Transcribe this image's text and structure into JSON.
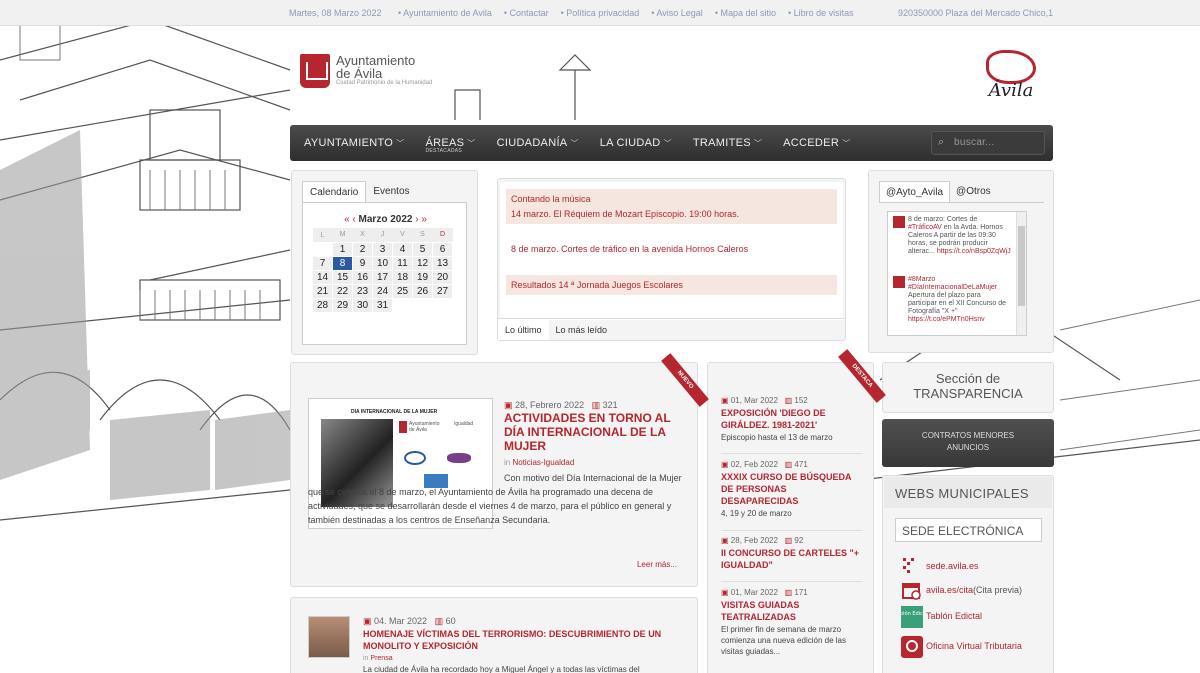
{
  "topbar": {
    "date": "Martes, 08 Marzo 2022",
    "links": [
      "Ayuntamiento de Avila",
      "Contactar",
      "Política privacidad",
      "Aviso Legal",
      "Mapa del sitio",
      "Libro de visitas"
    ],
    "address": "920350000 Plaza del Mercado Chico,1"
  },
  "logo": {
    "line1": "Ayuntamiento",
    "line2": "de Ávila",
    "tagline": "Ciudad Patrimonio de la Humanidad"
  },
  "avila_logo": "Ávila",
  "nav": {
    "items": [
      {
        "label": "AYUNTAMIENTO",
        "sub": ""
      },
      {
        "label": "ÁREAS",
        "sub": "DESTACADAS"
      },
      {
        "label": "CIUDADANÍA",
        "sub": ""
      },
      {
        "label": "LA CIUDAD",
        "sub": ""
      },
      {
        "label": "TRAMITES",
        "sub": ""
      },
      {
        "label": "ACCEDER",
        "sub": ""
      }
    ],
    "search_placeholder": "buscar..."
  },
  "calendar": {
    "tabs": [
      "Calendario",
      "Eventos"
    ],
    "month": "Marzo 2022",
    "prev": "« ‹",
    "next": "› »",
    "weekdays": [
      "L",
      "M",
      "X",
      "J",
      "V",
      "S",
      "D"
    ],
    "weeks": [
      [
        "",
        "1",
        "2",
        "3",
        "4",
        "5",
        "6"
      ],
      [
        "7",
        "8",
        "9",
        "10",
        "11",
        "12",
        "13"
      ],
      [
        "14",
        "15",
        "16",
        "17",
        "18",
        "19",
        "20"
      ],
      [
        "21",
        "22",
        "23",
        "24",
        "25",
        "26",
        "27"
      ],
      [
        "28",
        "29",
        "30",
        "31",
        "",
        "",
        ""
      ]
    ],
    "today": "8"
  },
  "news": {
    "items": [
      {
        "l1": "Contando la música",
        "l2": "14 marzo. El Réquiem de Mozart Episcopio. 19:00 horas."
      },
      {
        "l1": "8 de marzo. Cortes de tráfico en la avenida Hornos Caleros",
        "l2": ""
      },
      {
        "l1": "Resultados 14 ª Jornada Juegos Escolares",
        "l2": ""
      }
    ],
    "tabs": [
      "Lo último",
      "Lo más leído"
    ]
  },
  "twitter": {
    "tabs": [
      "@Ayto_Avila",
      "@Otros"
    ],
    "tweets": [
      {
        "pre": "8 de marzo: Cortes de ",
        "tag": "#TráficoAV",
        "text": " en la Avda. Hornos Caleros A partir de las 09:30 horas, se podrán producir alterac...",
        "link": "https://t.co/nBsp0ZqWjJ"
      },
      {
        "pre": "",
        "tag": "#8Marzo #DíaInternacionalDeLaMujer",
        "text": " Apertura del plazo para participar en el XII Concurso de Fotografía \"X +\"",
        "link": "https://t.co/ePMTn0Hsnv"
      }
    ]
  },
  "featured": {
    "ribbon": "NUEVO",
    "image_title": "DIA INTERNACIONAL DE LA MUJER",
    "image_logo1": "Ayuntamiento de Ávila",
    "image_logo2": "Igualdad",
    "date": "28, Febrero 2022",
    "views": "321",
    "title": "ACTIVIDADES EN TORNO AL DÍA INTERNACIONAL DE LA MUJER",
    "cat_prefix": "in",
    "category": "Noticias-Igualdad",
    "description": "Con motivo del Día Internacional de la Mujer que se celebra el 8 de marzo, el Ayuntamiento de Ávila ha programado una decena de actividades, que se desarrollarán desde el viernes 4 de marzo, para el público en general y también destinadas a los centros de Enseñanza Secundaria.",
    "more": "Leer más..."
  },
  "featured2": {
    "date": "04. Mar 2022",
    "views": "60",
    "title": "HOMENAJE VÍCTIMAS DEL TERRORISMO: DESCUBRIMIENTO DE UN MONOLITO Y EXPOSICIÓN",
    "cat_prefix": "in",
    "category": "Prensa",
    "description": "La ciudad de Ávila ha recordado hoy a Miguel Ángel y a todas las víctimas del"
  },
  "destacados": {
    "ribbon": "DESTACA",
    "items": [
      {
        "date": "01, Mar 2022",
        "views": "152",
        "title": "EXPOSICIÓN 'DIEGO DE GIRÁLDEZ. 1981-2021'",
        "desc": "Episcopio hasta el 13 de marzo"
      },
      {
        "date": "02, Feb 2022",
        "views": "471",
        "title": "XXXIX CURSO DE BÚSQUEDA DE PERSONAS DESAPARECIDAS",
        "desc": "4, 19 y 20 de marzo"
      },
      {
        "date": "28, Feb 2022",
        "views": "92",
        "title": "II CONCURSO DE CARTELES \"+ IGUALDAD\"",
        "desc": ""
      },
      {
        "date": "01, Mar 2022",
        "views": "171",
        "title": "VISITAS GUIADAS TEATRALIZADAS",
        "desc": "El primer fin de semana de marzo comienza una nueva edición de las visitas guiadas..."
      }
    ]
  },
  "transparencia": {
    "line1": "Sección de",
    "line2": "TRANSPARENCIA"
  },
  "contratos": {
    "line1": "CONTRATOS MENORES",
    "line2": "ANUNCIOS"
  },
  "webs": {
    "heading": "WEBS MUNICIPALES",
    "sede": "SEDE ELECTRÓNICA",
    "links": [
      {
        "label": "sede.avila.es",
        "extra": ""
      },
      {
        "label": "avila.es/cita",
        "extra": " (Cita previa)"
      },
      {
        "label": "Tablón Edictal",
        "extra": ""
      },
      {
        "label": "Oficina Virtual Tributaria",
        "extra": ""
      }
    ],
    "tablon_icon_text": "Tablón Edictal"
  },
  "colors": {
    "accent": "#b5262e",
    "nav": "#3a3a3a",
    "today": "#2c5aa0"
  }
}
